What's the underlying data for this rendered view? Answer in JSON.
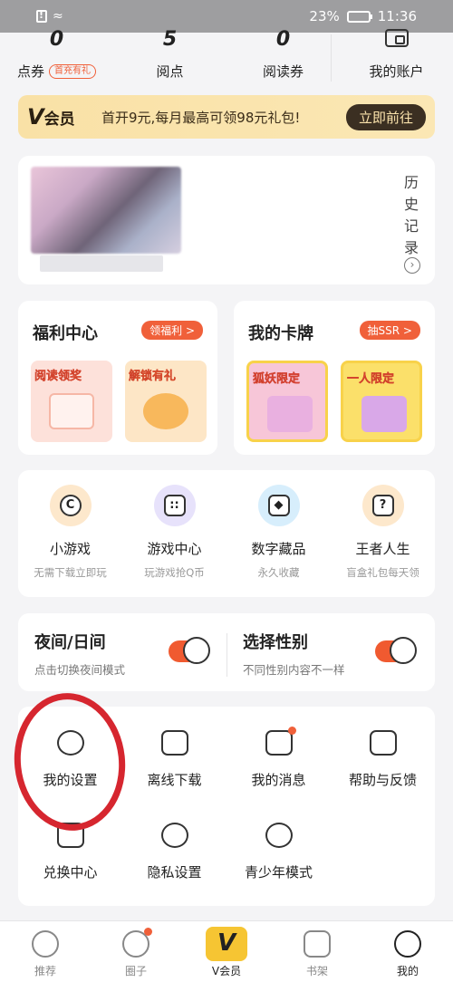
{
  "status": {
    "battery_percent": "23%",
    "time": "11:36"
  },
  "account": {
    "items": [
      {
        "value": "0",
        "label": "点券",
        "badge": "首充有礼"
      },
      {
        "value": "5",
        "label": "阅点"
      },
      {
        "value": "0",
        "label": "阅读券"
      },
      {
        "label": "我的账户"
      }
    ]
  },
  "vip": {
    "logo_v": "V",
    "logo_text": "会员",
    "text": "首开9元,每月最高可领98元礼包!",
    "button": "立即前往"
  },
  "history": {
    "label": "历史记录"
  },
  "welfare": {
    "title": "福利中心",
    "pill": "领福利 >",
    "tiles": [
      "阅读领奖",
      "解锁有礼"
    ]
  },
  "my_cards": {
    "title": "我的卡牌",
    "pill": "抽SSR >",
    "tiles": [
      "狐妖限定",
      "一人限定"
    ]
  },
  "games": [
    {
      "name": "小游戏",
      "sub": "无需下载立即玩"
    },
    {
      "name": "游戏中心",
      "sub": "玩游戏抢Q币"
    },
    {
      "name": "数字藏品",
      "sub": "永久收藏"
    },
    {
      "name": "王者人生",
      "sub": "盲盒礼包每天领"
    }
  ],
  "toggles": {
    "night": {
      "title": "夜间/日间",
      "desc": "点击切换夜间模式"
    },
    "gender": {
      "title": "选择性别",
      "desc": "不同性别内容不一样"
    }
  },
  "tools": [
    {
      "name": "我的设置"
    },
    {
      "name": "离线下载"
    },
    {
      "name": "我的消息"
    },
    {
      "name": "帮助与反馈"
    },
    {
      "name": "兑换中心"
    },
    {
      "name": "隐私设置"
    },
    {
      "name": "青少年模式"
    }
  ],
  "tabs": [
    {
      "label": "推荐"
    },
    {
      "label": "圈子"
    },
    {
      "label": "V会员",
      "glyph": "V"
    },
    {
      "label": "书架"
    },
    {
      "label": "我的"
    }
  ],
  "colors": {
    "accent": "#f0603a",
    "vip_gold": "#f9e1a6",
    "highlight": "#d6262f"
  }
}
